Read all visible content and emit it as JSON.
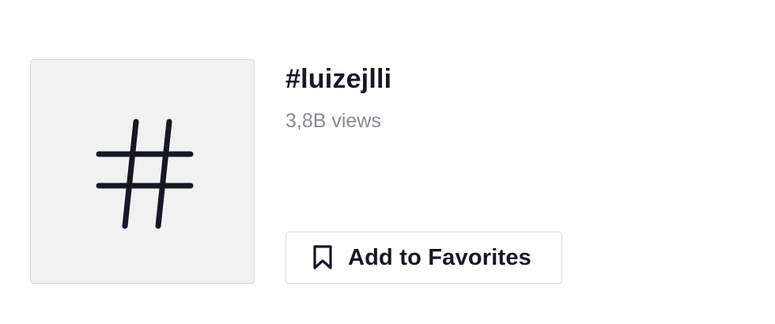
{
  "hashtag": {
    "title": "#luizejlli",
    "views": "3,8B views",
    "tile_icon": "hash-icon"
  },
  "actions": {
    "favorites_label": "Add to Favorites",
    "favorites_icon": "bookmark-icon"
  },
  "colors": {
    "text_primary": "#161823",
    "text_secondary": "#8a8b91",
    "tile_background": "#f1f1f1",
    "border": "#d9d9db"
  }
}
